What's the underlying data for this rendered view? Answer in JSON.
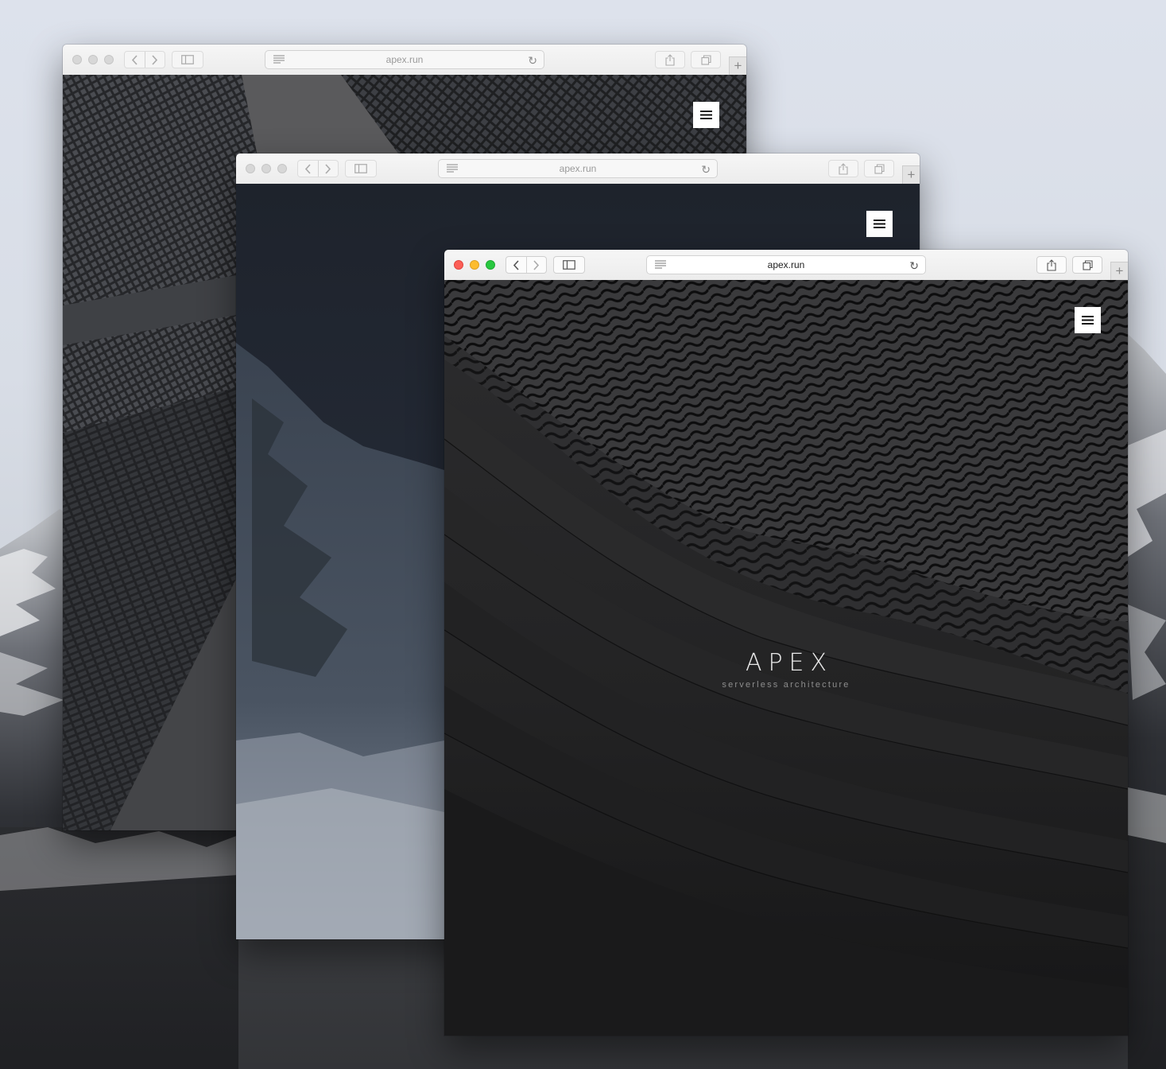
{
  "windows": [
    {
      "id": "back",
      "url": "apex.run",
      "state": "inactive",
      "background": "skyscrapers"
    },
    {
      "id": "middle",
      "url": "apex.run",
      "state": "inactive",
      "background": "snowy-mountain"
    },
    {
      "id": "front",
      "url": "apex.run",
      "state": "active",
      "background": "woven-architecture",
      "hero": {
        "brand": "APEX",
        "tagline": "serverless architecture"
      }
    }
  ],
  "icons": {
    "back": "chevron-left-icon",
    "forward": "chevron-right-icon",
    "sidebar": "sidebar-icon",
    "reader": "reader-icon",
    "reload": "reload-icon",
    "share": "share-icon",
    "tabs": "tabs-icon",
    "new_tab": "plus-icon",
    "menu": "hamburger-icon"
  },
  "colors": {
    "close": "#fc5f57",
    "minimize": "#fdbc2e",
    "zoom": "#28c840",
    "menu_button": "#ffffff"
  }
}
